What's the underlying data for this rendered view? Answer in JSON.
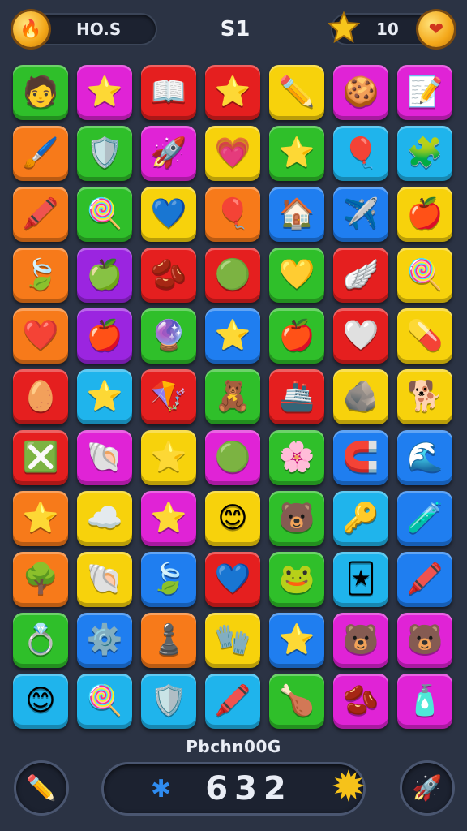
{
  "header": {
    "left_value": "HO.S",
    "level": "S1",
    "right_value": "10",
    "left_icon": "fire-coin-icon",
    "right_icon": "heart-coin-icon",
    "star_icon": "star-icon"
  },
  "board": {
    "tiles": [
      {
        "row": 0,
        "col": 0,
        "color": "green",
        "icon": "boy-face",
        "glyph": "🧑"
      },
      {
        "row": 0,
        "col": 1,
        "color": "magenta",
        "icon": "star",
        "glyph": "⭐"
      },
      {
        "row": 0,
        "col": 2,
        "color": "red",
        "icon": "book",
        "glyph": "📖"
      },
      {
        "row": 0,
        "col": 3,
        "color": "red",
        "icon": "star",
        "glyph": "⭐"
      },
      {
        "row": 0,
        "col": 4,
        "color": "yellow",
        "icon": "pencil-card",
        "glyph": "✏️"
      },
      {
        "row": 0,
        "col": 5,
        "color": "magenta",
        "icon": "cookie-face",
        "glyph": "🍪"
      },
      {
        "row": 0,
        "col": 6,
        "color": "magenta",
        "icon": "notebook",
        "glyph": "📝"
      },
      {
        "row": 1,
        "col": 0,
        "color": "orange",
        "icon": "paint-tube",
        "glyph": "🖌️"
      },
      {
        "row": 1,
        "col": 1,
        "color": "green",
        "icon": "badge",
        "glyph": "🛡️"
      },
      {
        "row": 1,
        "col": 2,
        "color": "magenta",
        "icon": "rocket",
        "glyph": "🚀"
      },
      {
        "row": 1,
        "col": 3,
        "color": "yellow",
        "icon": "heart",
        "glyph": "💗"
      },
      {
        "row": 1,
        "col": 4,
        "color": "green",
        "icon": "star",
        "glyph": "⭐"
      },
      {
        "row": 1,
        "col": 5,
        "color": "cyan",
        "icon": "balloon",
        "glyph": "🎈"
      },
      {
        "row": 1,
        "col": 6,
        "color": "cyan",
        "icon": "puzzle",
        "glyph": "🧩"
      },
      {
        "row": 2,
        "col": 0,
        "color": "orange",
        "icon": "crayon",
        "glyph": "🖍️"
      },
      {
        "row": 2,
        "col": 1,
        "color": "green",
        "icon": "lollipop",
        "glyph": "🍭"
      },
      {
        "row": 2,
        "col": 2,
        "color": "yellow",
        "icon": "heart",
        "glyph": "💙"
      },
      {
        "row": 2,
        "col": 3,
        "color": "orange",
        "icon": "balloon",
        "glyph": "🎈"
      },
      {
        "row": 2,
        "col": 4,
        "color": "blue",
        "icon": "house",
        "glyph": "🏠"
      },
      {
        "row": 2,
        "col": 5,
        "color": "blue",
        "icon": "airplane",
        "glyph": "✈️"
      },
      {
        "row": 2,
        "col": 6,
        "color": "yellow",
        "icon": "apple",
        "glyph": "🍎"
      },
      {
        "row": 3,
        "col": 0,
        "color": "orange",
        "icon": "leaf",
        "glyph": "🍃"
      },
      {
        "row": 3,
        "col": 1,
        "color": "purple",
        "icon": "apple",
        "glyph": "🍏"
      },
      {
        "row": 3,
        "col": 2,
        "color": "red",
        "icon": "bean",
        "glyph": "🫘"
      },
      {
        "row": 3,
        "col": 3,
        "color": "red",
        "icon": "blob-face",
        "glyph": "🟢"
      },
      {
        "row": 3,
        "col": 4,
        "color": "green",
        "icon": "heart",
        "glyph": "💛"
      },
      {
        "row": 3,
        "col": 5,
        "color": "red",
        "icon": "wing",
        "glyph": "🪽"
      },
      {
        "row": 3,
        "col": 6,
        "color": "yellow",
        "icon": "lollipop",
        "glyph": "🍭"
      },
      {
        "row": 4,
        "col": 0,
        "color": "orange",
        "icon": "heart",
        "glyph": "❤️"
      },
      {
        "row": 4,
        "col": 1,
        "color": "purple",
        "icon": "apple",
        "glyph": "🍎"
      },
      {
        "row": 4,
        "col": 2,
        "color": "green",
        "icon": "orb",
        "glyph": "🔮"
      },
      {
        "row": 4,
        "col": 3,
        "color": "blue",
        "icon": "star-card",
        "glyph": "⭐"
      },
      {
        "row": 4,
        "col": 4,
        "color": "green",
        "icon": "apple",
        "glyph": "🍎"
      },
      {
        "row": 4,
        "col": 5,
        "color": "red",
        "icon": "heart",
        "glyph": "🤍"
      },
      {
        "row": 4,
        "col": 6,
        "color": "yellow",
        "icon": "pill",
        "glyph": "💊"
      },
      {
        "row": 5,
        "col": 0,
        "color": "red",
        "icon": "bean",
        "glyph": "🥚"
      },
      {
        "row": 5,
        "col": 1,
        "color": "cyan",
        "icon": "star",
        "glyph": "⭐"
      },
      {
        "row": 5,
        "col": 2,
        "color": "red",
        "icon": "kite",
        "glyph": "🪁"
      },
      {
        "row": 5,
        "col": 3,
        "color": "green",
        "icon": "toys",
        "glyph": "🧸"
      },
      {
        "row": 5,
        "col": 4,
        "color": "red",
        "icon": "boat",
        "glyph": "🚢"
      },
      {
        "row": 5,
        "col": 5,
        "color": "yellow",
        "icon": "stone",
        "glyph": "🪨"
      },
      {
        "row": 5,
        "col": 6,
        "color": "yellow",
        "icon": "animal",
        "glyph": "🐕"
      },
      {
        "row": 6,
        "col": 0,
        "color": "red",
        "icon": "cross",
        "glyph": "❎"
      },
      {
        "row": 6,
        "col": 1,
        "color": "magenta",
        "icon": "shell",
        "glyph": "🐚"
      },
      {
        "row": 6,
        "col": 2,
        "color": "yellow",
        "icon": "star",
        "glyph": "⭐"
      },
      {
        "row": 6,
        "col": 3,
        "color": "magenta",
        "icon": "blob-face",
        "glyph": "🟢"
      },
      {
        "row": 6,
        "col": 4,
        "color": "green",
        "icon": "flower",
        "glyph": "🌸"
      },
      {
        "row": 6,
        "col": 5,
        "color": "blue",
        "icon": "magnet",
        "glyph": "🧲"
      },
      {
        "row": 6,
        "col": 6,
        "color": "blue",
        "icon": "wave",
        "glyph": "🌊"
      },
      {
        "row": 7,
        "col": 0,
        "color": "orange",
        "icon": "star",
        "glyph": "⭐"
      },
      {
        "row": 7,
        "col": 1,
        "color": "yellow",
        "icon": "cloud",
        "glyph": "☁️"
      },
      {
        "row": 7,
        "col": 2,
        "color": "magenta",
        "icon": "star",
        "glyph": "⭐"
      },
      {
        "row": 7,
        "col": 3,
        "color": "yellow",
        "icon": "blob-face",
        "glyph": "😊"
      },
      {
        "row": 7,
        "col": 4,
        "color": "green",
        "icon": "bear-face",
        "glyph": "🐻"
      },
      {
        "row": 7,
        "col": 5,
        "color": "cyan",
        "icon": "key",
        "glyph": "🔑"
      },
      {
        "row": 7,
        "col": 6,
        "color": "blue",
        "icon": "bottle",
        "glyph": "🧪"
      },
      {
        "row": 8,
        "col": 0,
        "color": "orange",
        "icon": "tree",
        "glyph": "🌳"
      },
      {
        "row": 8,
        "col": 1,
        "color": "yellow",
        "icon": "shell",
        "glyph": "🐚"
      },
      {
        "row": 8,
        "col": 2,
        "color": "blue",
        "icon": "leaf",
        "glyph": "🍃"
      },
      {
        "row": 8,
        "col": 3,
        "color": "red",
        "icon": "heart",
        "glyph": "💙"
      },
      {
        "row": 8,
        "col": 4,
        "color": "green",
        "icon": "frog-face",
        "glyph": "🐸"
      },
      {
        "row": 8,
        "col": 5,
        "color": "cyan",
        "icon": "card",
        "glyph": "🃏"
      },
      {
        "row": 8,
        "col": 6,
        "color": "blue",
        "icon": "crayon",
        "glyph": "🖍️"
      },
      {
        "row": 9,
        "col": 0,
        "color": "green",
        "icon": "ring",
        "glyph": "💍"
      },
      {
        "row": 9,
        "col": 1,
        "color": "blue",
        "icon": "gear",
        "glyph": "⚙️"
      },
      {
        "row": 9,
        "col": 2,
        "color": "orange",
        "icon": "chess-piece",
        "glyph": "♟️"
      },
      {
        "row": 9,
        "col": 3,
        "color": "yellow",
        "icon": "glove",
        "glyph": "🧤"
      },
      {
        "row": 9,
        "col": 4,
        "color": "blue",
        "icon": "starfish",
        "glyph": "⭐"
      },
      {
        "row": 9,
        "col": 5,
        "color": "magenta",
        "icon": "bear-face",
        "glyph": "🐻"
      },
      {
        "row": 9,
        "col": 6,
        "color": "magenta",
        "icon": "bear-face",
        "glyph": "🐻"
      },
      {
        "row": 10,
        "col": 0,
        "color": "cyan",
        "icon": "smiley",
        "glyph": "😊"
      },
      {
        "row": 10,
        "col": 1,
        "color": "cyan",
        "icon": "lollipop",
        "glyph": "🍭"
      },
      {
        "row": 10,
        "col": 2,
        "color": "cyan",
        "icon": "shield",
        "glyph": "🛡️"
      },
      {
        "row": 10,
        "col": 3,
        "color": "cyan",
        "icon": "crayon",
        "glyph": "🖍️"
      },
      {
        "row": 10,
        "col": 4,
        "color": "green",
        "icon": "chicken-leg",
        "glyph": "🍗"
      },
      {
        "row": 10,
        "col": 5,
        "color": "magenta",
        "icon": "bean",
        "glyph": "🫘"
      },
      {
        "row": 10,
        "col": 6,
        "color": "magenta",
        "icon": "bottle",
        "glyph": "🧴"
      }
    ]
  },
  "footer": {
    "hint_text": "Pbchn00G",
    "score": "632",
    "left_button_icon": "pencil-icon",
    "right_button_icon": "rocket-icon",
    "score_left_icon": "gear-icon",
    "score_right_icon": "sun-icon"
  },
  "colors": {
    "background": "#2b3344",
    "green": "#2fbf2a",
    "magenta": "#e023d6",
    "red": "#e51f1f",
    "yellow": "#f7d20c",
    "orange": "#f77a1a",
    "cyan": "#1fb4ec",
    "blue": "#1f7ef0",
    "purple": "#9b25e0"
  }
}
